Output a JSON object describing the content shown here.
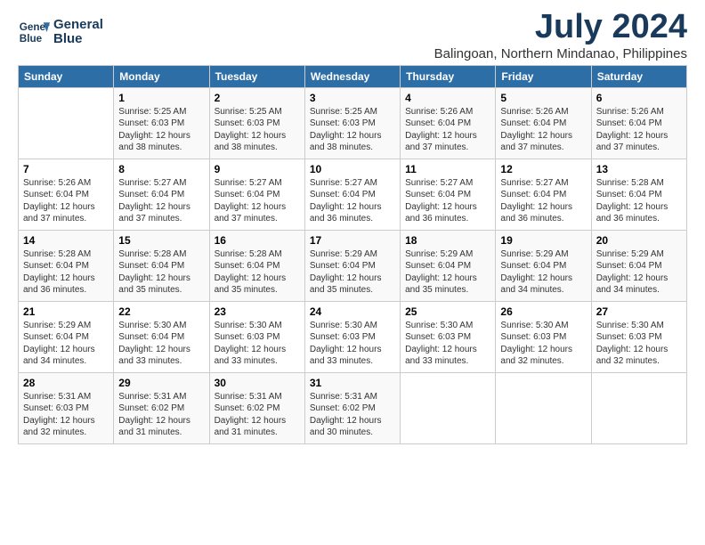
{
  "header": {
    "logo_line1": "General",
    "logo_line2": "Blue",
    "month": "July 2024",
    "location": "Balingoan, Northern Mindanao, Philippines"
  },
  "days_of_week": [
    "Sunday",
    "Monday",
    "Tuesday",
    "Wednesday",
    "Thursday",
    "Friday",
    "Saturday"
  ],
  "weeks": [
    [
      {
        "num": "",
        "info": ""
      },
      {
        "num": "1",
        "info": "Sunrise: 5:25 AM\nSunset: 6:03 PM\nDaylight: 12 hours\nand 38 minutes."
      },
      {
        "num": "2",
        "info": "Sunrise: 5:25 AM\nSunset: 6:03 PM\nDaylight: 12 hours\nand 38 minutes."
      },
      {
        "num": "3",
        "info": "Sunrise: 5:25 AM\nSunset: 6:03 PM\nDaylight: 12 hours\nand 38 minutes."
      },
      {
        "num": "4",
        "info": "Sunrise: 5:26 AM\nSunset: 6:04 PM\nDaylight: 12 hours\nand 37 minutes."
      },
      {
        "num": "5",
        "info": "Sunrise: 5:26 AM\nSunset: 6:04 PM\nDaylight: 12 hours\nand 37 minutes."
      },
      {
        "num": "6",
        "info": "Sunrise: 5:26 AM\nSunset: 6:04 PM\nDaylight: 12 hours\nand 37 minutes."
      }
    ],
    [
      {
        "num": "7",
        "info": "Sunrise: 5:26 AM\nSunset: 6:04 PM\nDaylight: 12 hours\nand 37 minutes."
      },
      {
        "num": "8",
        "info": "Sunrise: 5:27 AM\nSunset: 6:04 PM\nDaylight: 12 hours\nand 37 minutes."
      },
      {
        "num": "9",
        "info": "Sunrise: 5:27 AM\nSunset: 6:04 PM\nDaylight: 12 hours\nand 37 minutes."
      },
      {
        "num": "10",
        "info": "Sunrise: 5:27 AM\nSunset: 6:04 PM\nDaylight: 12 hours\nand 36 minutes."
      },
      {
        "num": "11",
        "info": "Sunrise: 5:27 AM\nSunset: 6:04 PM\nDaylight: 12 hours\nand 36 minutes."
      },
      {
        "num": "12",
        "info": "Sunrise: 5:27 AM\nSunset: 6:04 PM\nDaylight: 12 hours\nand 36 minutes."
      },
      {
        "num": "13",
        "info": "Sunrise: 5:28 AM\nSunset: 6:04 PM\nDaylight: 12 hours\nand 36 minutes."
      }
    ],
    [
      {
        "num": "14",
        "info": "Sunrise: 5:28 AM\nSunset: 6:04 PM\nDaylight: 12 hours\nand 36 minutes."
      },
      {
        "num": "15",
        "info": "Sunrise: 5:28 AM\nSunset: 6:04 PM\nDaylight: 12 hours\nand 35 minutes."
      },
      {
        "num": "16",
        "info": "Sunrise: 5:28 AM\nSunset: 6:04 PM\nDaylight: 12 hours\nand 35 minutes."
      },
      {
        "num": "17",
        "info": "Sunrise: 5:29 AM\nSunset: 6:04 PM\nDaylight: 12 hours\nand 35 minutes."
      },
      {
        "num": "18",
        "info": "Sunrise: 5:29 AM\nSunset: 6:04 PM\nDaylight: 12 hours\nand 35 minutes."
      },
      {
        "num": "19",
        "info": "Sunrise: 5:29 AM\nSunset: 6:04 PM\nDaylight: 12 hours\nand 34 minutes."
      },
      {
        "num": "20",
        "info": "Sunrise: 5:29 AM\nSunset: 6:04 PM\nDaylight: 12 hours\nand 34 minutes."
      }
    ],
    [
      {
        "num": "21",
        "info": "Sunrise: 5:29 AM\nSunset: 6:04 PM\nDaylight: 12 hours\nand 34 minutes."
      },
      {
        "num": "22",
        "info": "Sunrise: 5:30 AM\nSunset: 6:04 PM\nDaylight: 12 hours\nand 33 minutes."
      },
      {
        "num": "23",
        "info": "Sunrise: 5:30 AM\nSunset: 6:03 PM\nDaylight: 12 hours\nand 33 minutes."
      },
      {
        "num": "24",
        "info": "Sunrise: 5:30 AM\nSunset: 6:03 PM\nDaylight: 12 hours\nand 33 minutes."
      },
      {
        "num": "25",
        "info": "Sunrise: 5:30 AM\nSunset: 6:03 PM\nDaylight: 12 hours\nand 33 minutes."
      },
      {
        "num": "26",
        "info": "Sunrise: 5:30 AM\nSunset: 6:03 PM\nDaylight: 12 hours\nand 32 minutes."
      },
      {
        "num": "27",
        "info": "Sunrise: 5:30 AM\nSunset: 6:03 PM\nDaylight: 12 hours\nand 32 minutes."
      }
    ],
    [
      {
        "num": "28",
        "info": "Sunrise: 5:31 AM\nSunset: 6:03 PM\nDaylight: 12 hours\nand 32 minutes."
      },
      {
        "num": "29",
        "info": "Sunrise: 5:31 AM\nSunset: 6:02 PM\nDaylight: 12 hours\nand 31 minutes."
      },
      {
        "num": "30",
        "info": "Sunrise: 5:31 AM\nSunset: 6:02 PM\nDaylight: 12 hours\nand 31 minutes."
      },
      {
        "num": "31",
        "info": "Sunrise: 5:31 AM\nSunset: 6:02 PM\nDaylight: 12 hours\nand 30 minutes."
      },
      {
        "num": "",
        "info": ""
      },
      {
        "num": "",
        "info": ""
      },
      {
        "num": "",
        "info": ""
      }
    ]
  ]
}
